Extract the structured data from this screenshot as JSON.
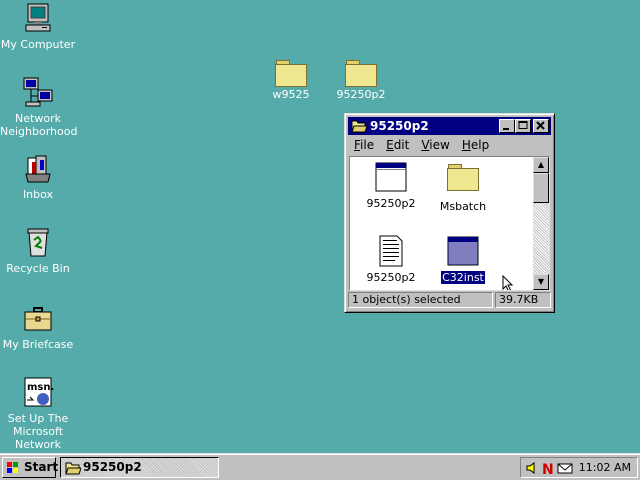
{
  "desktop": {
    "icons": [
      {
        "label": "My Computer"
      },
      {
        "label": "Network Neighborhood"
      },
      {
        "label": "Inbox"
      },
      {
        "label": "Recycle Bin"
      },
      {
        "label": "My Briefcase"
      },
      {
        "label": "Set Up The Microsoft Network"
      },
      {
        "label": "w9525"
      },
      {
        "label": "95250p2"
      }
    ]
  },
  "window": {
    "title": "95250p2",
    "menu": [
      "File",
      "Edit",
      "View",
      "Help"
    ],
    "menu_underline": [
      "F",
      "E",
      "V",
      "H"
    ],
    "items": [
      {
        "label": "95250p2",
        "icon": "program-icon",
        "selected": false
      },
      {
        "label": "Msbatch",
        "icon": "folder-icon",
        "selected": false
      },
      {
        "label": "95250p2",
        "icon": "text-document-icon",
        "selected": false
      },
      {
        "label": "C32inst",
        "icon": "program-icon",
        "selected": true
      }
    ],
    "status_left": "1 object(s) selected",
    "status_right": "39.7KB"
  },
  "taskbar": {
    "start_label": "Start",
    "task_label": "95250p2",
    "clock": "11:02 AM"
  },
  "colors": {
    "desktop": "#55aaaa",
    "title_active": "#000080",
    "face": "#c0c0c0"
  }
}
